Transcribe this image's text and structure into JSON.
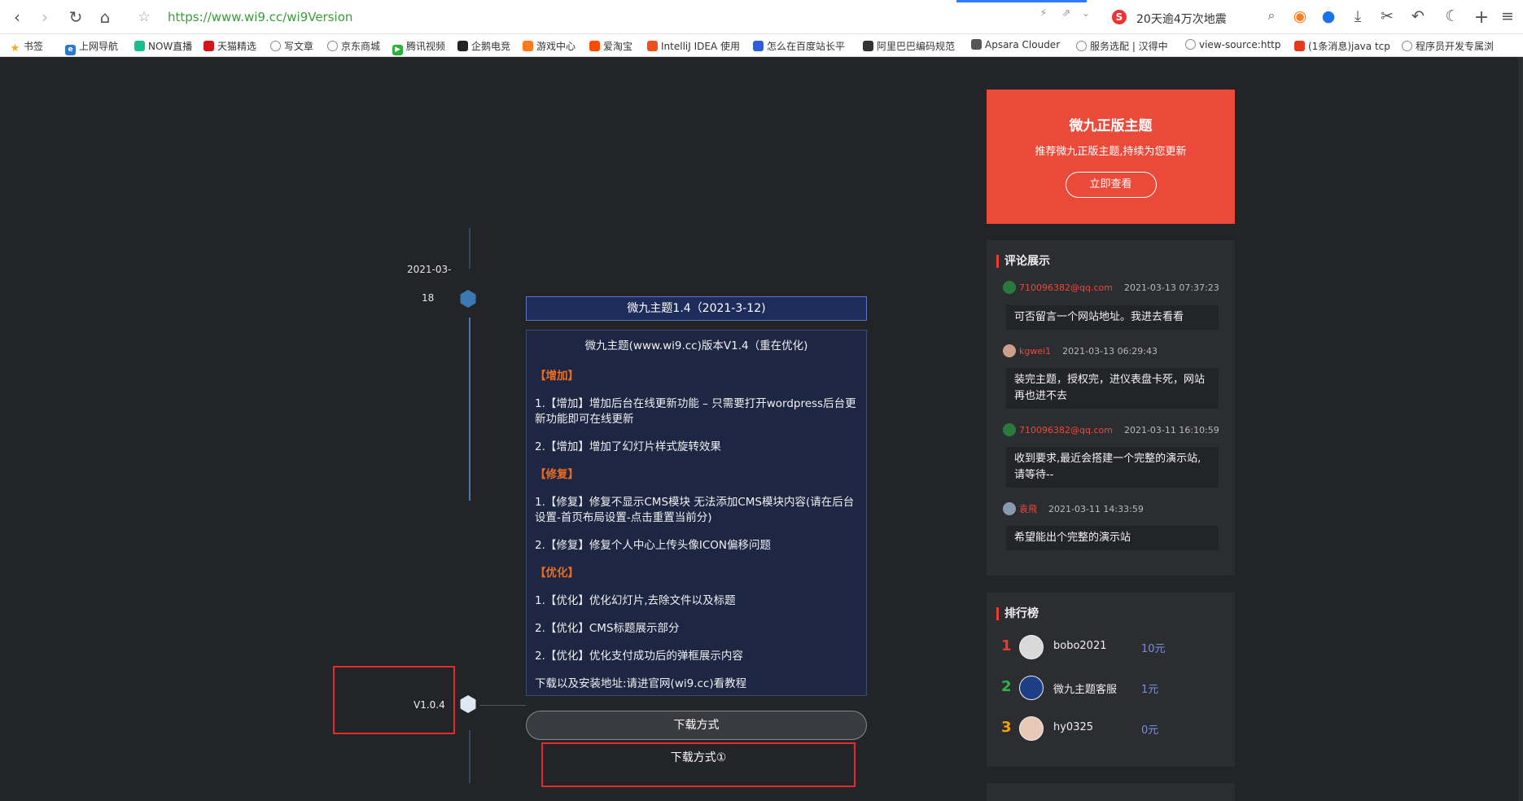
{
  "browser": {
    "url": "https://www.wi9.cc/wi9Version",
    "news_text": "20天逾4万次地震",
    "bookmarks": [
      {
        "label": "书签",
        "icon": "star-icon",
        "color": "#f5a623"
      },
      {
        "label": "上网导航",
        "icon": "e-icon",
        "color": "#2a7ad5"
      },
      {
        "label": "NOW直播",
        "icon": "now-icon",
        "color": "#18c08f"
      },
      {
        "label": "天猫精选",
        "icon": "tmall-icon",
        "color": "#d3141c"
      },
      {
        "label": "写文章",
        "icon": "globe-icon",
        "color": "#888888"
      },
      {
        "label": "京东商城",
        "icon": "globe-icon",
        "color": "#888888"
      },
      {
        "label": "腾讯视频",
        "icon": "play-icon",
        "color": "#2ab13a"
      },
      {
        "label": "企鹅电竞",
        "icon": "penguin-icon",
        "color": "#222222"
      },
      {
        "label": "游戏中心",
        "icon": "gamepad-icon",
        "color": "#ff7a1a"
      },
      {
        "label": "爱淘宝",
        "icon": "taobao-icon",
        "color": "#ff4a00"
      },
      {
        "label": "IntelliJ IDEA 使用",
        "icon": "idea-icon",
        "color": "#f24e1e"
      },
      {
        "label": "怎么在百度站长平",
        "icon": "baidu-icon",
        "color": "#2f5fd8"
      },
      {
        "label": "阿里巴巴编码规范",
        "icon": "alibaba-icon",
        "color": "#333333"
      },
      {
        "label": "Apsara Clouder",
        "icon": "apsara-icon",
        "color": "#555555"
      },
      {
        "label": "服务选配 | 汉得中",
        "icon": "globe-icon",
        "color": "#888888"
      },
      {
        "label": "view-source:http",
        "icon": "globe-icon",
        "color": "#888888"
      },
      {
        "label": "(1条消息)java tcp",
        "icon": "csdn-icon",
        "color": "#e33b1c"
      },
      {
        "label": "程序员开发专属浏",
        "icon": "globe-icon",
        "color": "#888888"
      }
    ]
  },
  "timeline": {
    "date_line1": "2021-03-",
    "date_line2": "18",
    "version_label": "V1.0.4",
    "title": "微九主题1.4（2021-3-12)",
    "content": {
      "headline": "微九主题(www.wi9.cc)版本V1.4（重在优化)",
      "sec_add": "【增加】",
      "add_1": "1.【增加】增加后台在线更新功能 – 只需要打开wordpress后台更新功能即可在线更新",
      "add_2": "2.【增加】增加了幻灯片样式旋转效果",
      "sec_fix": "【修复】",
      "fix_1": "1.【修复】修复不显示CMS模块 无法添加CMS模块内容(请在后台设置-首页布局设置-点击重置当前分)",
      "fix_2": "2.【修复】修复个人中心上传头像ICON偏移问题",
      "sec_opt": "【优化】",
      "opt_1": "1.【优化】优化幻灯片,去除文件以及标题",
      "opt_2": "2.【优化】CMS标题展示部分",
      "opt_3": "2.【优化】优化支付成功后的弹框展示内容",
      "footer": "下载以及安装地址:请进官网(wi9.cc)看教程"
    },
    "download_button": "下载方式",
    "download_option": "下载方式①"
  },
  "sidebar": {
    "promo": {
      "title": "微九正版主题",
      "subtitle": "推荐微九正版主题,持续为您更新",
      "button": "立即查看",
      "color": "#eb4a3a"
    },
    "comments": {
      "heading": "评论展示",
      "items": [
        {
          "user": "710096382@qq.com",
          "time": "2021-03-13 07:37:23",
          "text": "可否留言一个网站地址。我进去看看"
        },
        {
          "user": "kgwei1",
          "time": "2021-03-13 06:29:43",
          "text": "装完主题，授权完，进仪表盘卡死，网站再也进不去"
        },
        {
          "user": "710096382@qq.com",
          "time": "2021-03-11 16:10:59",
          "text": "收到要求,最近会搭建一个完整的演示站,请等待--"
        },
        {
          "user": "袁飛",
          "time": "2021-03-11 14:33:59",
          "text": "希望能出个完整的演示站"
        }
      ]
    },
    "ranking": {
      "heading": "排行榜",
      "items": [
        {
          "rank": "1",
          "name": "bobo2021",
          "value": "10元",
          "color": "#e53d2f"
        },
        {
          "rank": "2",
          "name": "微九主题客服",
          "value": "1元",
          "color": "#2db34a"
        },
        {
          "rank": "3",
          "name": "hy0325",
          "value": "0元",
          "color": "#f2a20c"
        }
      ]
    }
  }
}
